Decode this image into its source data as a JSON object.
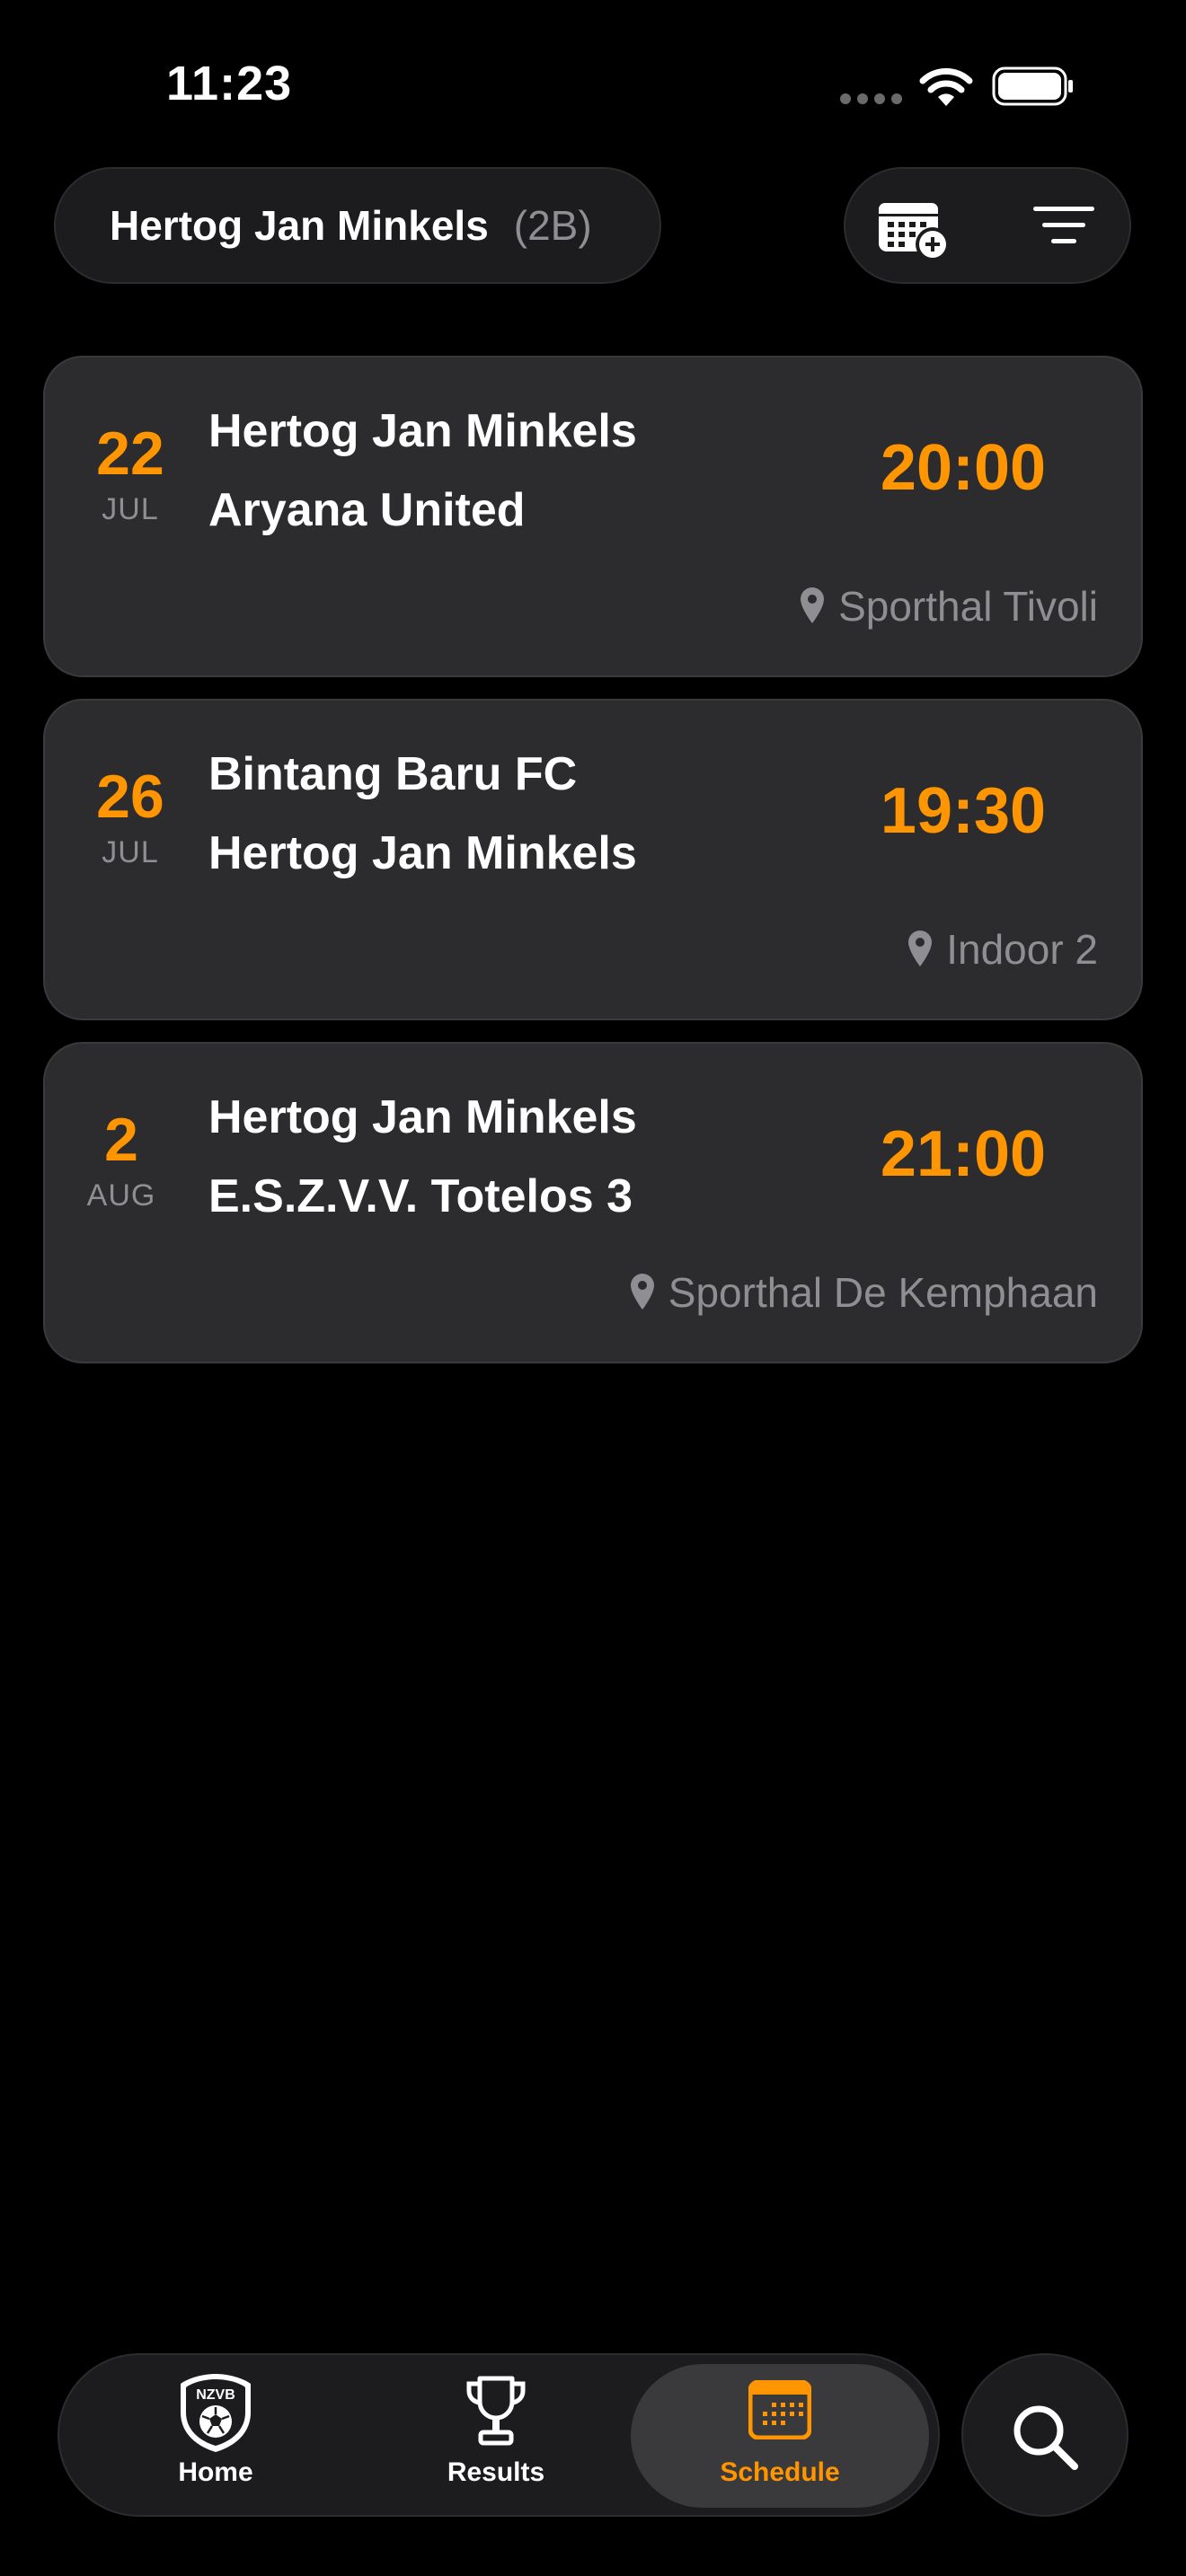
{
  "status_bar": {
    "time": "11:23"
  },
  "header": {
    "team_name": "Hertog Jan Minkels",
    "division": "(2B)"
  },
  "matches": [
    {
      "day": "22",
      "month": "JUL",
      "home": "Hertog Jan Minkels",
      "away": "Aryana United",
      "time": "20:00",
      "venue": "Sporthal Tivoli"
    },
    {
      "day": "26",
      "month": "JUL",
      "home": "Bintang Baru FC",
      "away": "Hertog Jan Minkels",
      "time": "19:30",
      "venue": "Indoor 2"
    },
    {
      "day": "2",
      "month": "AUG",
      "home": "Hertog Jan Minkels",
      "away": "E.S.Z.V.V. Totelos 3",
      "time": "21:00",
      "venue": "Sporthal De Kemphaan"
    }
  ],
  "tabbar": {
    "home_label": "Home",
    "home_logo_text": "NZVB",
    "results_label": "Results",
    "schedule_label": "Schedule",
    "active_tab": "schedule"
  },
  "colors": {
    "accent": "#ff9500",
    "card": "#2c2c2e",
    "secondary_text": "#8e8e93"
  }
}
